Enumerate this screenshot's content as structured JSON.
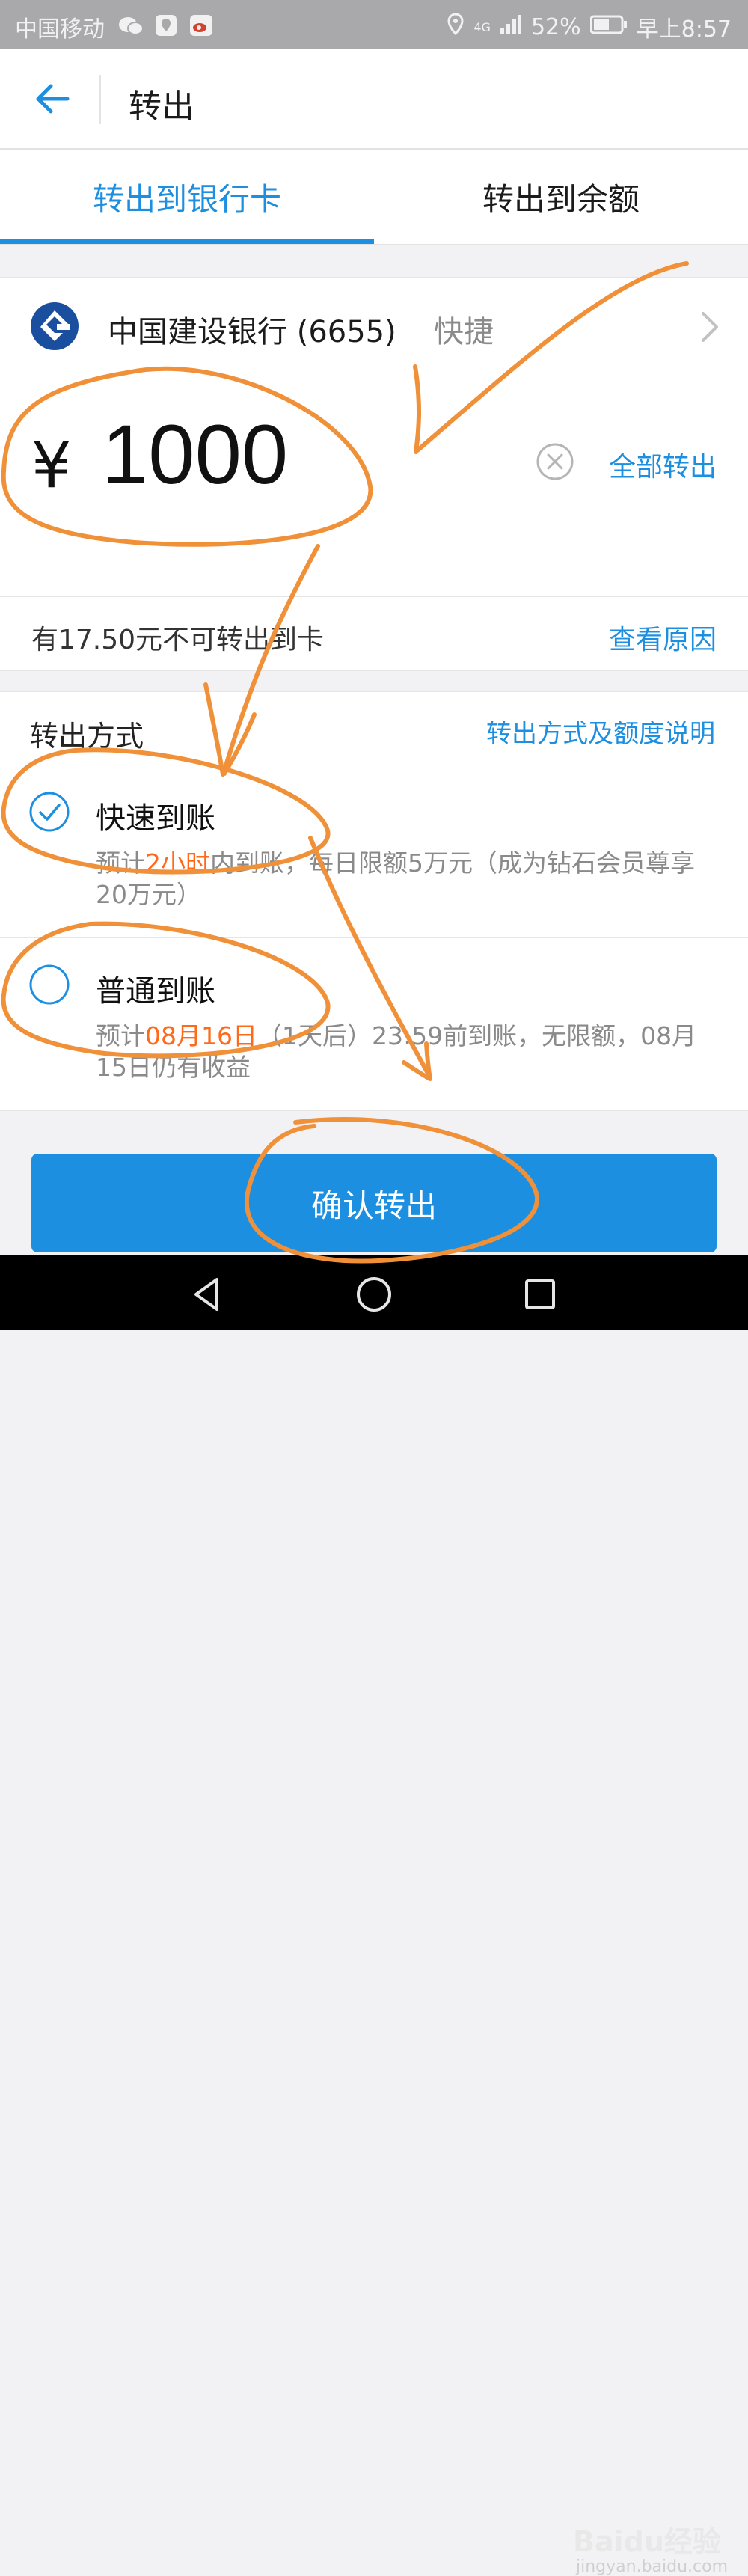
{
  "status_bar": {
    "carrier": "中国移动",
    "network": "4G",
    "battery": "52%",
    "time": "早上8:57"
  },
  "header": {
    "title": "转出"
  },
  "tabs": [
    {
      "label": "转出到银行卡",
      "active": true
    },
    {
      "label": "转出到余额",
      "active": false
    }
  ],
  "bank": {
    "name": "中国建设银行 (6655)",
    "tag": "快捷"
  },
  "amount": {
    "currency": "¥",
    "value": "1000",
    "withdraw_all": "全部转出"
  },
  "notice": {
    "text": "有17.50元不可转出到卡",
    "link": "查看原因"
  },
  "methods": {
    "title": "转出方式",
    "link": "转出方式及额度说明",
    "options": [
      {
        "title": "快速到账",
        "checked": true,
        "desc_pre": "预计",
        "desc_hl": "2小时",
        "desc_post": "内到账，每日限额5万元（成为钻石会员尊享20万元）"
      },
      {
        "title": "普通到账",
        "checked": false,
        "desc_pre": "预计",
        "desc_hl": "08月16日",
        "desc_post": "（1天后）23:59前到账，无限额，08月15日仍有收益"
      }
    ]
  },
  "confirm": {
    "label": "确认转出"
  },
  "watermark": {
    "brand": "Baidu经验",
    "url": "jingyan.baidu.com"
  },
  "colors": {
    "accent": "#1c8fe0",
    "highlight": "#ff6a1a",
    "annotation": "#f0913a"
  }
}
